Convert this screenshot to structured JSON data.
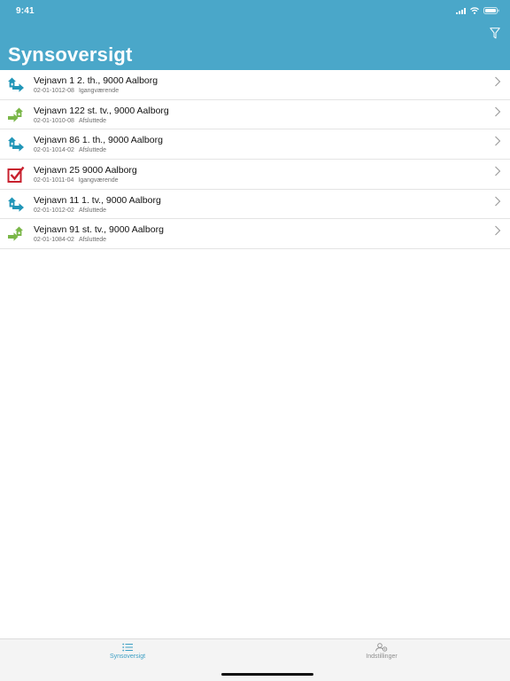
{
  "status_bar": {
    "time": "9:41"
  },
  "header": {
    "title": "Synsoversigt",
    "filter_icon": "filter-icon"
  },
  "colors": {
    "header_bg": "#4aa7c9",
    "ongoing_icon": "#2196b8",
    "done_icon": "#7ab648",
    "checked_icon": "#c8202e",
    "tab_active": "#3d9fc4"
  },
  "items": [
    {
      "title": "Vejnavn 1 2. th., 9000 Aalborg",
      "code": "02-01-1012-08",
      "status": "Igangværende",
      "icon": "house-arrow-blue-icon"
    },
    {
      "title": "Vejnavn 122 st. tv., 9000 Aalborg",
      "code": "02-01-1010-08",
      "status": "Afsluttede",
      "icon": "house-arrow-green-icon"
    },
    {
      "title": "Vejnavn 86 1. th., 9000 Aalborg",
      "code": "02-01-1014-02",
      "status": "Afsluttede",
      "icon": "house-arrow-blue-icon"
    },
    {
      "title": "Vejnavn 25 9000 Aalborg",
      "code": "02-01-1011-04",
      "status": "Igangværende",
      "icon": "checkbox-checked-icon"
    },
    {
      "title": "Vejnavn 11 1. tv., 9000 Aalborg",
      "code": "02-01-1012-02",
      "status": "Afsluttede",
      "icon": "house-arrow-blue-icon"
    },
    {
      "title": "Vejnavn 91 st. tv., 9000 Aalborg",
      "code": "02-01-1084-02",
      "status": "Afsluttede",
      "icon": "house-arrow-green-icon"
    }
  ],
  "tabbar": {
    "tabs": [
      {
        "label": "Synsoversigt",
        "icon": "list-icon",
        "active": true
      },
      {
        "label": "Indstillinger",
        "icon": "user-settings-icon",
        "active": false
      }
    ]
  }
}
